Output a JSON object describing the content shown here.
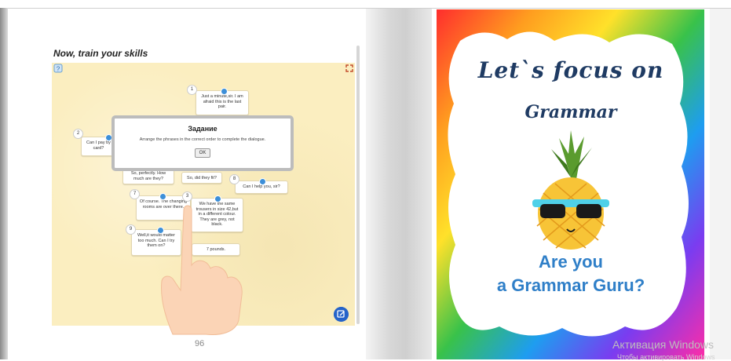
{
  "left_page": {
    "heading": "Now, train your skills",
    "page_number": "96",
    "cards": [
      {
        "num": "1",
        "text": "Just a minute,sir. I am afraid this is the last pair."
      },
      {
        "num": "2",
        "text": "Can I pay by card?"
      },
      {
        "num": "",
        "text": "So, perfectly. How much are they?"
      },
      {
        "num": "",
        "text": "So, did they fit?"
      },
      {
        "num": "8",
        "text": "Can I help you, sir?"
      },
      {
        "num": "7",
        "text": "Of course. The changing rooms are over there."
      },
      {
        "num": "3",
        "text": "We have the same trousers in size 42,but in a different colour. They are grey, not black."
      },
      {
        "num": "9",
        "text": "Well,it would matter too much. Can I try them on?"
      },
      {
        "num": "",
        "text": "7 pounds."
      }
    ],
    "dialog": {
      "title": "Задание",
      "text": "Arrange the phrases in the correct order to complete the dialogue.",
      "ok_label": "OK"
    },
    "icons": [
      "help-icon",
      "fullscreen-icon",
      "edit-tool-icon",
      "pointing-hand"
    ]
  },
  "right_page": {
    "line1": "Let`s focus on",
    "line2": "Grammar",
    "line3": "Are you",
    "line4": "a Grammar Guru?"
  },
  "watermark": {
    "line1": "Активация Windows",
    "line2": "Чтобы активировать Windows"
  },
  "colors": {
    "widget_bg": "#fbeec0",
    "title_navy": "#1f3b63",
    "cover_blue": "#2f7fc8",
    "dot_blue": "#3d8fd8"
  }
}
